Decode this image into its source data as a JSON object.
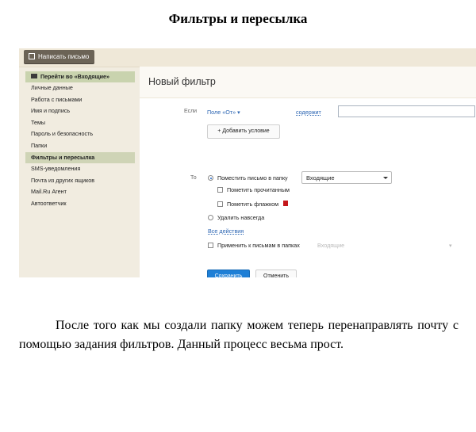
{
  "document": {
    "title": "Фильтры и пересылка",
    "paragraph": "После того как мы создали папку можем теперь перенаправлять почту с помощью задания фильтров. Данный процесс весьма прост."
  },
  "mail": {
    "compose_label": "Написать письмо",
    "sidebar": {
      "header": "Перейти во «Входящие»",
      "items": [
        "Личные данные",
        "Работа с письмами",
        "Имя и подпись",
        "Темы",
        "Пароль и безопасность",
        "Папки",
        "Фильтры и пересылка",
        "SMS-уведомления",
        "Почта из других ящиков",
        "Mail.Ru Агент",
        "Автоответчик"
      ],
      "active_index": 6
    },
    "filter": {
      "title": "Новый фильтр",
      "if_label": "Если",
      "field_select": "Поле «От»",
      "condition": "содержит",
      "condition_value": "",
      "add_condition": "+ Добавить условие",
      "to_label": "То",
      "move_label": "Поместить письмо в папку",
      "folder_value": "Входящие",
      "mark_read": "Пометить прочитанным",
      "mark_flag": "Пометить флажком",
      "delete_forever": "Удалить навсегда",
      "all_actions": "Все действия",
      "apply_existing": "Применить к письмам в папках",
      "apply_folder": "Входящие",
      "save": "Сохранить",
      "cancel": "Отменить"
    },
    "colors": {
      "primary_button": "#1e7fd6",
      "link": "#2a64b2",
      "sidebar_active": "#cfd4b6",
      "flag": "#c4171b"
    }
  }
}
